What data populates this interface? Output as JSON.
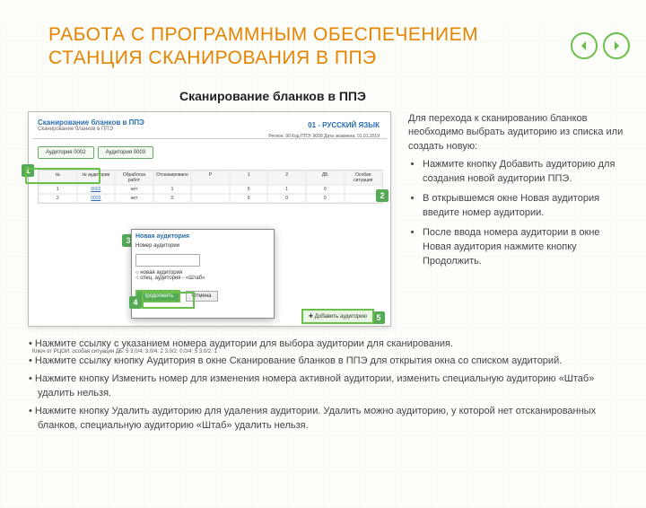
{
  "title_line1": "РАБОТА С ПРОГРАММНЫМ ОБЕСПЕЧЕНИЕМ",
  "title_line2": "СТАНЦИЯ СКАНИРОВАНИЯ В ППЭ",
  "section_title": "Сканирование бланков в ППЭ",
  "screenshot": {
    "window_title": "Сканирование бланков в ППЭ",
    "window_sub": "Сканирование бланков в ППЭ",
    "subject": "01 - РУССКИЙ ЯЗЫК",
    "info": "Регион: 90   Код ППЭ: 9099   Дата экзамена: 01.01.2019",
    "tab1": "Аудитория 0002",
    "tab2": "Аудитория 0003",
    "table_header_cells": [
      "№",
      "№ аудитории",
      "Обработка работ",
      "Отсканировано",
      "Р",
      "1",
      "2",
      "ДБ",
      "Особая ситуация"
    ],
    "table_row1": [
      "1",
      "0002",
      "нет",
      "1",
      "",
      "0",
      "1",
      "0",
      ""
    ],
    "table_row2": [
      "2",
      "0003",
      "нет",
      "0",
      "",
      "0",
      "0",
      "0",
      ""
    ],
    "dialog_title": "Новая аудитория",
    "dialog_label": "Номер аудитории",
    "dialog_radio1": "новая аудитория",
    "dialog_radio2": "спец. аудитория - «Штаб»",
    "dialog_continue": "Продолжить",
    "dialog_cancel": "Отмена",
    "add_btn": "Добавить аудиторию",
    "bottom_caption": "Ключ от РЦОИ: особая ситуация\nДБ: 5 3.0/4: 3.0/4: 2 3.0/2: 0.0/4: 5 3.0/2: 1"
  },
  "right": {
    "intro": "Для перехода к сканированию бланков необходимо выбрать аудиторию из списка или создать новую:",
    "items": [
      "Нажмите кнопку Добавить аудиторию для создания новой аудитории ППЭ.",
      "В открывшемся окне Новая аудитория введите номер аудитории.",
      "После ввода номера аудитории в окне Новая аудитория нажмите кнопку Продолжить."
    ]
  },
  "bottom": [
    "•      Нажмите ссылку с указанием номера аудитории для выбора аудитории для сканирования.",
    "•      Нажмите ссылку кнопку Аудитория в окне Сканирование бланков в ППЭ для открытия окна со списком аудиторий.",
    "•      Нажмите кнопку Изменить номер для изменения номера активной аудитории, изменить специальную аудиторию «Штаб»   удалить нельзя.",
    "•      Нажмите кнопку Удалить аудиторию для удаления аудитории. Удалить можно аудиторию, у которой нет отсканированных бланков, специальную аудиторию «Штаб» удалить нельзя."
  ]
}
